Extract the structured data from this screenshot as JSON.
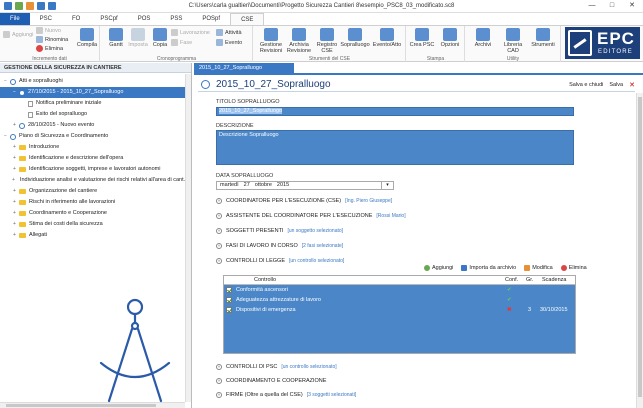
{
  "window": {
    "title": "C:\\Users\\carla gualtieri\\Documenti\\Progetto Sicurezza Cantieri 8\\esempio_PSC8_03_modificato.sc8",
    "controls": [
      "—",
      "□",
      "✕"
    ]
  },
  "tabs": [
    {
      "label": "File",
      "kind": "file"
    },
    {
      "label": "PSC"
    },
    {
      "label": "FO"
    },
    {
      "label": "PSCpf"
    },
    {
      "label": "POS"
    },
    {
      "label": "PSS"
    },
    {
      "label": "POSpf"
    },
    {
      "label": "CSE",
      "active": true
    }
  ],
  "ribbon": {
    "small": {
      "aggiungi": "Aggiungi",
      "nuovo": "Nuovo",
      "rinomina": "Rinomina",
      "elimina": "Elimina",
      "lavorazione": "Lavorazione",
      "fase": "Fase",
      "attivita": "Attività",
      "evento": "Evento"
    },
    "big": {
      "compila": "Compila",
      "gantt": "Gantt",
      "imposta": "Imposta",
      "copia": "Copia",
      "gestione_revisioni": "Gestione Revisioni",
      "archivia_revisione": "Archivia Revisione",
      "registro_cse": "Registro CSE",
      "sopralluogo": "Sopralluogo",
      "evento_atto": "Evento/Atto",
      "crea_psc": "Crea PSC",
      "opzioni": "Opzioni",
      "archivi": "Archivi",
      "libreria_cad": "Libreria CAD",
      "strumenti": "Strumenti"
    },
    "groups": {
      "incremento": "Incremento dati",
      "cronoprogramma": "Cronoprogramma",
      "strumenti_cse": "Strumenti del CSE",
      "stampa": "Stampa",
      "utility": "Utility"
    }
  },
  "brand": {
    "name": "EPC",
    "sub": "EDITORE"
  },
  "left_panel": {
    "header": "GESTIONE DELLA SICUREZZA IN CANTIERE",
    "tree": [
      {
        "label": "Atti e sopralluoghi",
        "level": 0,
        "exp": "−",
        "icon": "clock"
      },
      {
        "label": "27/10/2015 - 2015_10_27_Sopralluogo",
        "level": 1,
        "exp": "−",
        "icon": "clock",
        "selected": true
      },
      {
        "label": "Notifica preliminare iniziale",
        "level": 2,
        "icon": "doc"
      },
      {
        "label": "Esito del sopralluogo",
        "level": 2,
        "icon": "doc"
      },
      {
        "label": "28/10/2015 - Nuovo evento",
        "level": 1,
        "exp": "+",
        "icon": "clock"
      },
      {
        "label": "Piano di Sicurezza e Coordinamento",
        "level": 0,
        "exp": "−",
        "icon": "clock"
      },
      {
        "label": "Introduzione",
        "level": 1,
        "exp": "+",
        "icon": "folder"
      },
      {
        "label": "Identificazione e descrizione dell'opera",
        "level": 1,
        "exp": "+",
        "icon": "folder"
      },
      {
        "label": "Identificazione soggetti, imprese e lavoratori autonomi",
        "level": 1,
        "exp": "+",
        "icon": "folder"
      },
      {
        "label": "Individuazione analisi e valutazione dei rischi relativi all'area di cant...",
        "level": 1,
        "exp": "+",
        "icon": "folder"
      },
      {
        "label": "Organizzazione del cantiere",
        "level": 1,
        "exp": "+",
        "icon": "folder"
      },
      {
        "label": "Rischi in riferimento alle lavorazioni",
        "level": 1,
        "exp": "+",
        "icon": "folder"
      },
      {
        "label": "Coordinamento e Cooperazione",
        "level": 1,
        "exp": "+",
        "icon": "folder"
      },
      {
        "label": "Stima dei costi della sicurezza",
        "level": 1,
        "exp": "+",
        "icon": "folder"
      },
      {
        "label": "Allegati",
        "level": 1,
        "exp": "+",
        "icon": "folder"
      }
    ]
  },
  "doc": {
    "tab": "2015_10_27_Sopralluogo",
    "title": "2015_10_27_Sopralluogo",
    "actions": {
      "save_close": "Salva e chiudi",
      "save": "Salva",
      "close": "✕"
    },
    "titolo_label": "TITOLO SOPRALLUOGO",
    "titolo_value": "2015_10_27_Sopralluogo",
    "descrizione_label": "DESCRIZIONE",
    "descrizione_value": "Descrizione Sopralluogo",
    "data_label": "DATA SOPRALLUOGO",
    "data": {
      "weekday": "martedì",
      "day": "27",
      "month": "ottobre",
      "year": "2015"
    },
    "sections": [
      {
        "title": "COORDINATORE PER L'ESECUZIONE (CSE)",
        "link": "[Ing. Piero Giuseppe]",
        "mark": "v"
      },
      {
        "title": "ASSISTENTE DEL COORDINATORE PER L'ESECUZIONE",
        "link": "[Rossi Mario]",
        "mark": "v"
      },
      {
        "title": "SOGGETTI PRESENTI",
        "link": "[un soggetto selezionato]",
        "mark": "v"
      },
      {
        "title": "FASI DI LAVORO IN CORSO",
        "link": "[2 fasi selezionate]",
        "mark": "v"
      },
      {
        "title": "CONTROLLI DI LEGGE",
        "link": "[un controllo selezionato]",
        "mark": "^"
      }
    ],
    "grid_toolbar": {
      "add": "Aggiungi",
      "import": "Importa da archivio",
      "edit": "Modifica",
      "delete": "Elimina"
    },
    "grid": {
      "headers": {
        "controllo": "Controllo",
        "conf": "Conf.",
        "gr": "Gr.",
        "scadenza": "Scadenza"
      },
      "rows": [
        {
          "controllo": "Conformità ascensori",
          "conf": "✔",
          "gr": "",
          "scadenza": ""
        },
        {
          "controllo": "Adeguatezza attrezzature di lavoro",
          "conf": "✔",
          "gr": "",
          "scadenza": ""
        },
        {
          "controllo": "Dispositivi di emergenza",
          "conf": "✖",
          "gr": "3",
          "scadenza": "30/10/2015"
        }
      ]
    },
    "sections_after": [
      {
        "title": "CONTROLLI DI PSC",
        "link": "[un controllo selezionato]",
        "mark": "v"
      },
      {
        "title": "COORDINAMENTO E COOPERAZIONE",
        "link": "",
        "mark": "v"
      },
      {
        "title": "FIRME (Oltre a quella del CSE)",
        "link": "[3 soggetti selezionati]",
        "mark": "v"
      }
    ]
  }
}
